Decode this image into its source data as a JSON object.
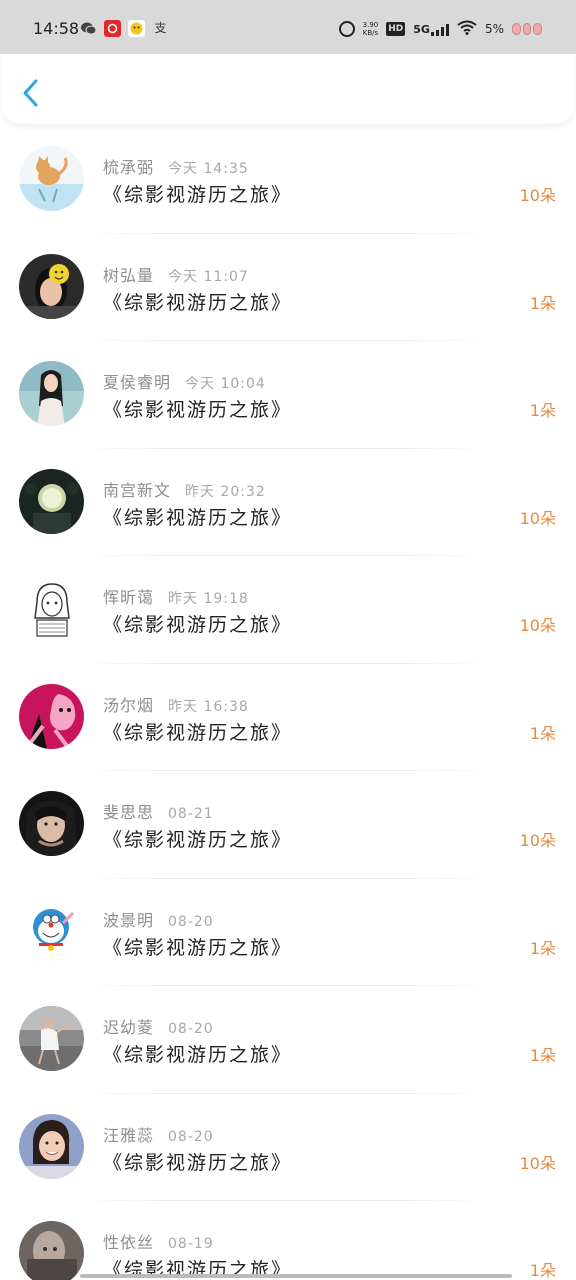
{
  "status_bar": {
    "time": "14:58",
    "app_icons": [
      "wechat-icon",
      "red-app-icon",
      "emoji-app-icon",
      "alipay-icon"
    ],
    "app_glyphs": [
      "",
      "",
      "",
      "支"
    ],
    "net_speed_value": "3.90",
    "net_speed_unit": "KB/s",
    "hd_label": "HD",
    "network_label": "5G",
    "battery_text": "5%"
  },
  "header": {
    "back_icon": "chevron-left-icon",
    "accent": "#2aa7e0"
  },
  "colors": {
    "count": "#e58a3f",
    "name": "#8f8f8f",
    "title": "#222222"
  },
  "items": [
    {
      "name": "梳承弼",
      "time": "今天 14:35",
      "title": "《综影视游历之旅》",
      "count": "10朵",
      "avatar": "cat-cartoon"
    },
    {
      "name": "树弘量",
      "time": "今天 11:07",
      "title": "《综影视游历之旅》",
      "count": "1朵",
      "avatar": "girl-sticker-face"
    },
    {
      "name": "夏侯睿明",
      "time": "今天 10:04",
      "title": "《综影视游历之旅》",
      "count": "1朵",
      "avatar": "girl-photo"
    },
    {
      "name": "南宫新文",
      "time": "昨天 20:32",
      "title": "《综影视游历之旅》",
      "count": "10朵",
      "avatar": "night-scene"
    },
    {
      "name": "恽昕蔼",
      "time": "昨天 19:18",
      "title": "《综影视游历之旅》",
      "count": "10朵",
      "avatar": "sketch-girl"
    },
    {
      "name": "汤尔烟",
      "time": "昨天 16:38",
      "title": "《综影视游历之旅》",
      "count": "1朵",
      "avatar": "pink-panther"
    },
    {
      "name": "斐思思",
      "time": "08-21",
      "title": "《综影视游历之旅》",
      "count": "10朵",
      "avatar": "dark-portrait"
    },
    {
      "name": "波景明",
      "time": "08-20",
      "title": "《综影视游历之旅》",
      "count": "1朵",
      "avatar": "doraemon"
    },
    {
      "name": "迟幼菱",
      "time": "08-20",
      "title": "《综影视游历之旅》",
      "count": "1朵",
      "avatar": "dancer"
    },
    {
      "name": "汪雅蕊",
      "time": "08-20",
      "title": "《综影视游历之旅》",
      "count": "10朵",
      "avatar": "smiling-girl"
    },
    {
      "name": "性依丝",
      "time": "08-19",
      "title": "《综影视游历之旅》",
      "count": "1朵",
      "avatar": "grey-photo"
    }
  ]
}
